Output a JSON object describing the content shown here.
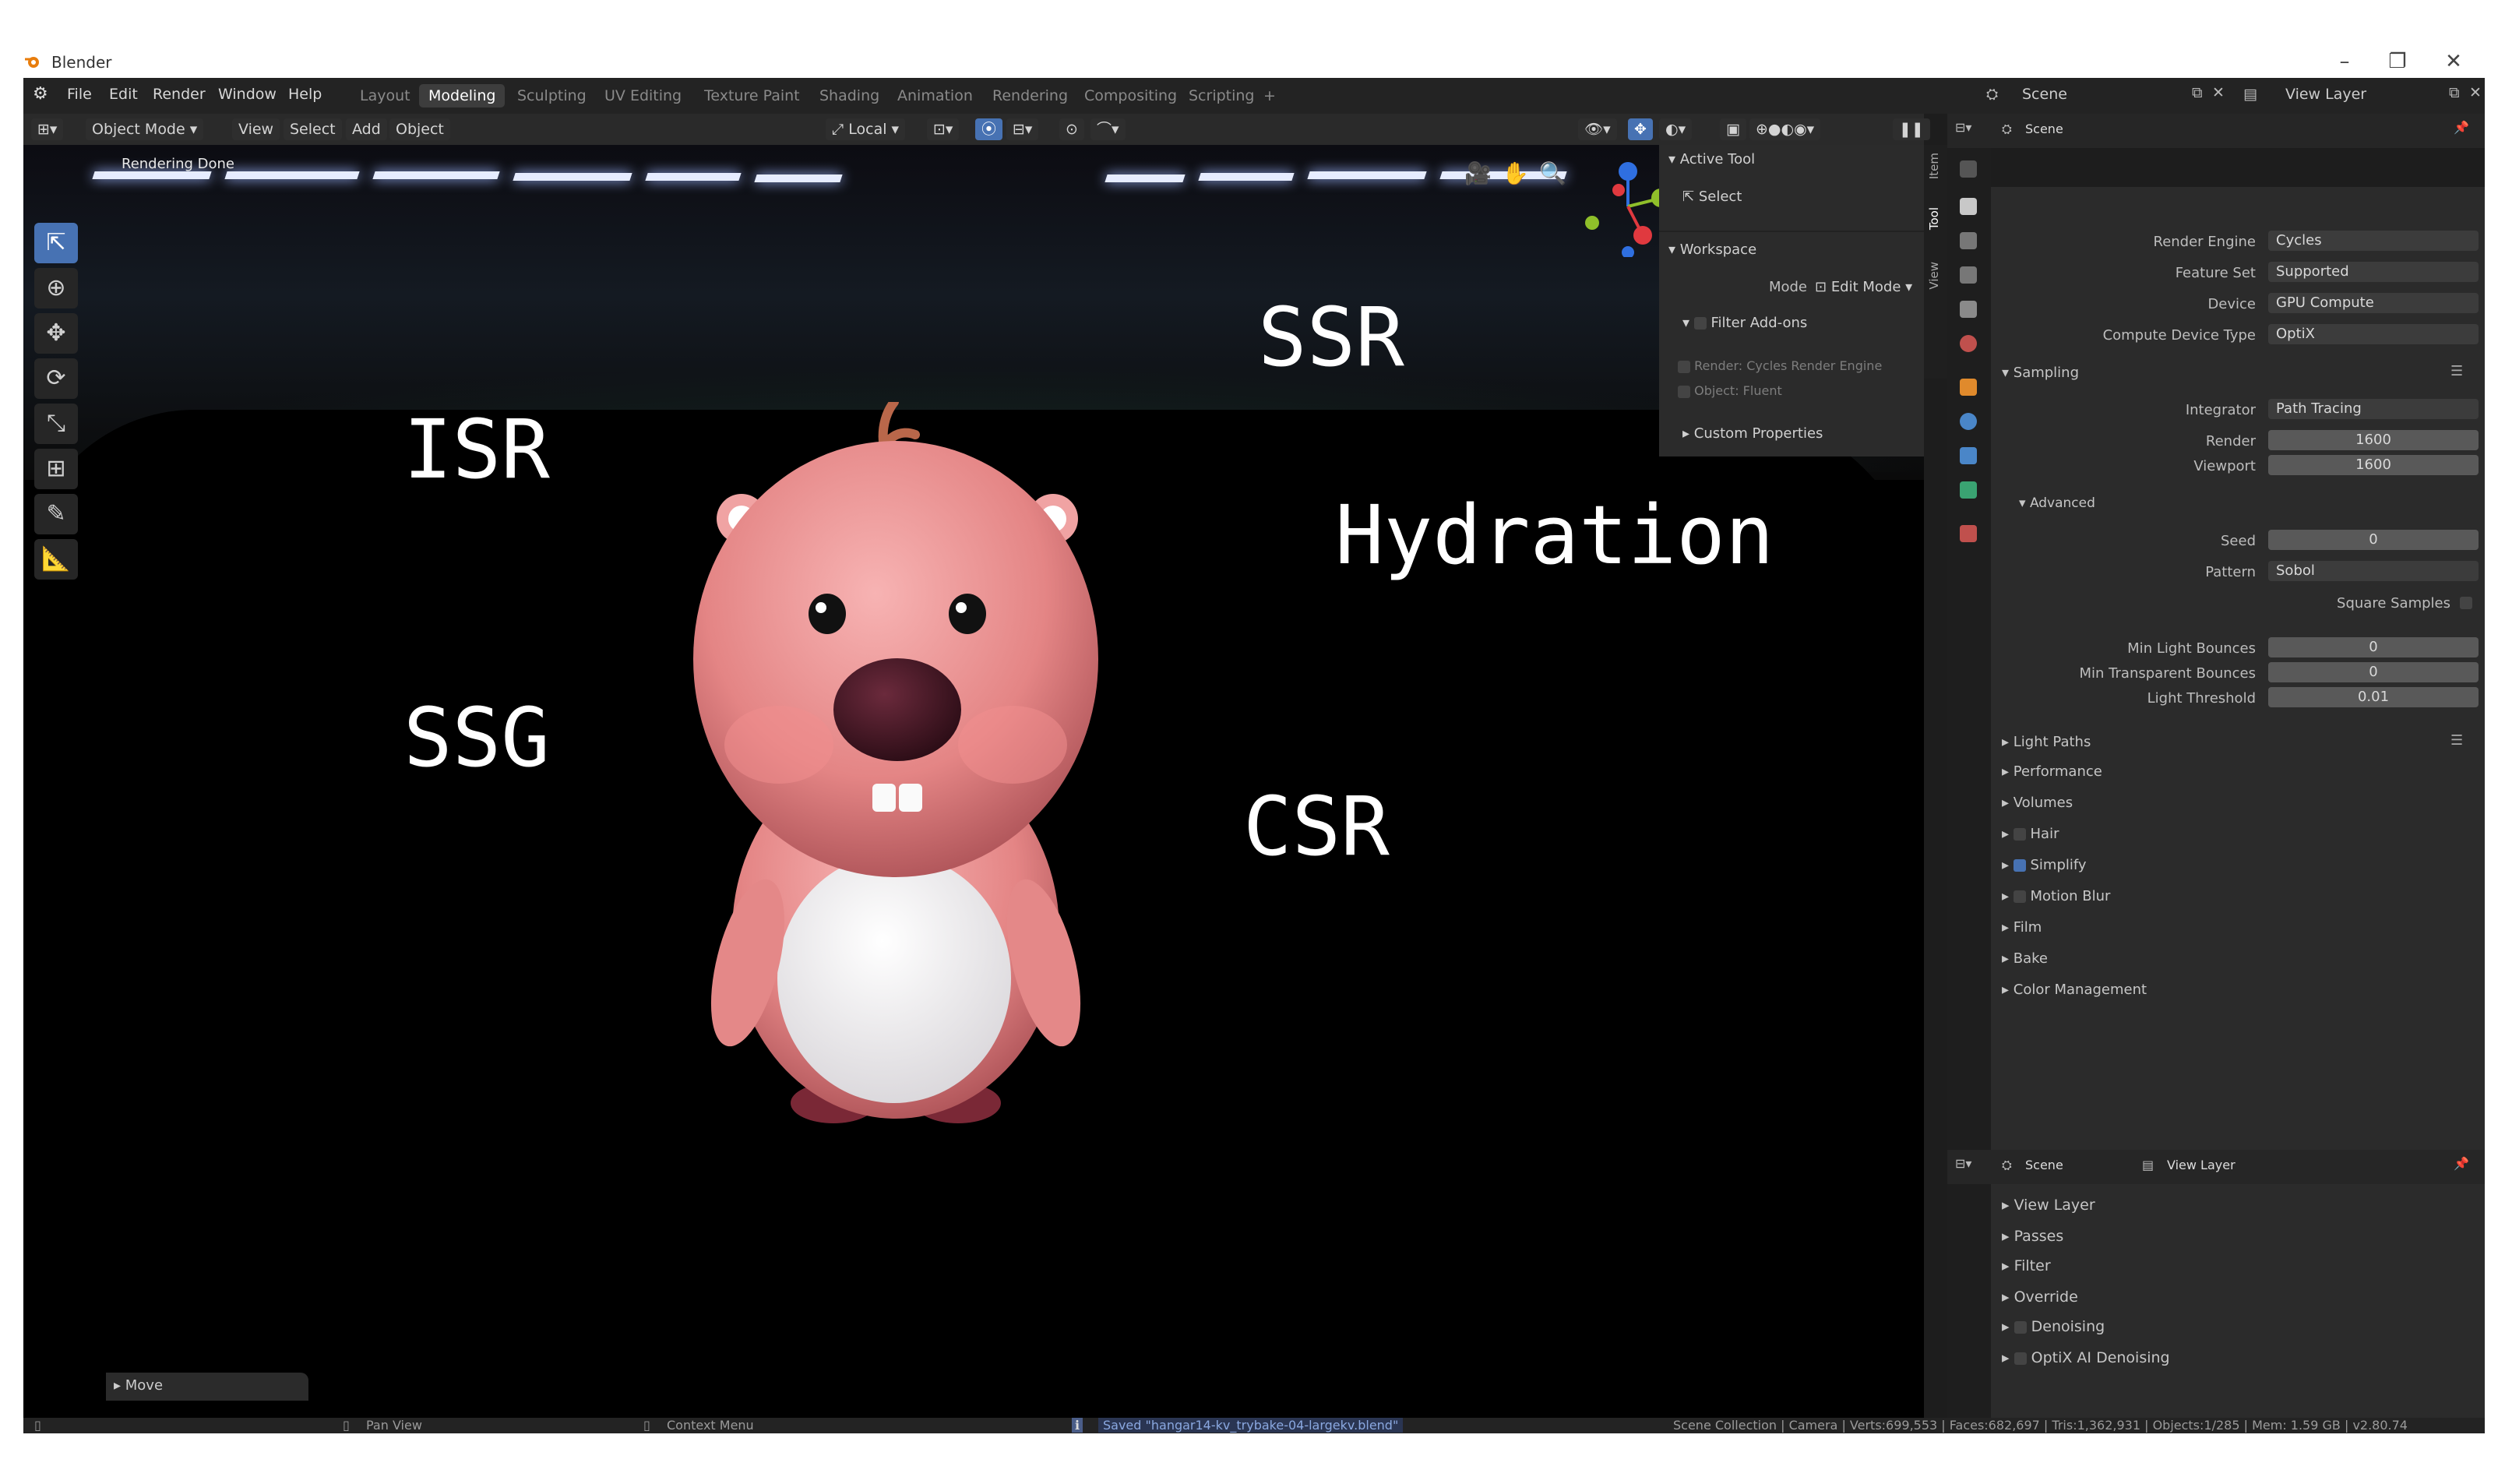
{
  "window": {
    "title": "Blender",
    "minimize": "–",
    "maximize": "❐",
    "close": "✕"
  },
  "menu": [
    "File",
    "Edit",
    "Render",
    "Window",
    "Help"
  ],
  "workspaces": [
    "Layout",
    "Modeling",
    "Sculpting",
    "UV Editing",
    "Texture Paint",
    "Shading",
    "Animation",
    "Rendering",
    "Compositing",
    "Scripting",
    "+"
  ],
  "active_workspace": "Modeling",
  "topbar_right": {
    "scene": "Scene",
    "view_layer": "View Layer"
  },
  "header": {
    "mode": "Object Mode",
    "view": "View",
    "select": "Select",
    "add": "Add",
    "object": "Object",
    "orientation": "Local"
  },
  "viewport": {
    "status": "Rendering Done",
    "labels": {
      "ssr": "SSR",
      "isr": "ISR",
      "hydration": "Hydration",
      "ssg": "SSG",
      "csr": "CSR"
    },
    "last_op": "Move"
  },
  "npanel": {
    "active_tool": "Active Tool",
    "select": "Select",
    "workspace": "Workspace",
    "mode_label": "Mode",
    "mode_value": "Edit Mode",
    "filter_addons": "Filter Add-ons",
    "addon1": "Render: Cycles Render Engine",
    "addon2": "Object: Fluent",
    "custom_props": "Custom Properties",
    "tabs": [
      "Item",
      "Tool",
      "View"
    ]
  },
  "props": {
    "scene": "Scene",
    "render_engine_label": "Render Engine",
    "render_engine": "Cycles",
    "feature_set_label": "Feature Set",
    "feature_set": "Supported",
    "device_label": "Device",
    "device": "GPU Compute",
    "compute_type_label": "Compute Device Type",
    "compute_type": "OptiX",
    "sampling": "Sampling",
    "integrator_label": "Integrator",
    "integrator": "Path Tracing",
    "render_label": "Render",
    "render_samples": "1600",
    "viewport_label": "Viewport",
    "viewport_samples": "1600",
    "advanced": "Advanced",
    "seed_label": "Seed",
    "seed": "0",
    "pattern_label": "Pattern",
    "pattern": "Sobol",
    "square_samples": "Square Samples",
    "min_light_label": "Min Light Bounces",
    "min_light": "0",
    "min_transp_label": "Min Transparent Bounces",
    "min_transp": "0",
    "light_threshold_label": "Light Threshold",
    "light_threshold": "0.01",
    "sections": [
      "Light Paths",
      "Performance",
      "Volumes",
      "Hair",
      "Simplify",
      "Motion Blur",
      "Film",
      "Bake",
      "Color Management"
    ]
  },
  "props2": {
    "scene": "Scene",
    "view_layer": "View Layer",
    "sections": [
      "View Layer",
      "Passes",
      "Filter",
      "Override",
      "Denoising",
      "OptiX AI Denoising"
    ]
  },
  "status": {
    "pan": "Pan View",
    "context": "Context Menu",
    "saved": "Saved \"hangar14-kv_trybake-04-largekv.blend\"",
    "stats": "Scene Collection | Camera | Verts:699,553 | Faces:682,697 | Tris:1,362,931 | Objects:1/285 | Mem: 1.59 GB | v2.80.74"
  }
}
